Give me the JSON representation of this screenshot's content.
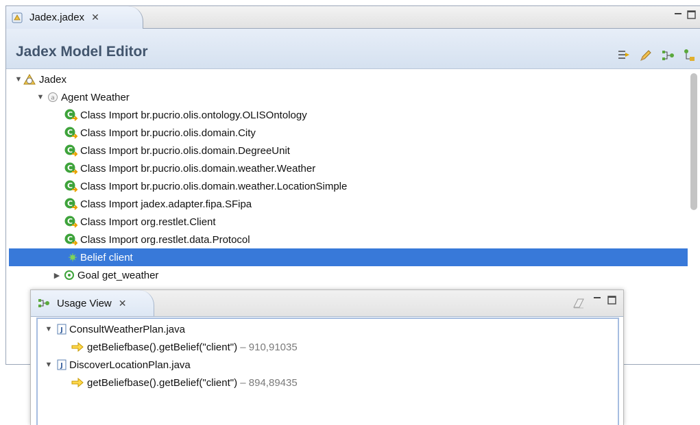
{
  "editor": {
    "tab_label": "Jadex.jadex",
    "close_glyph": "✕",
    "title": "Jadex Model Editor",
    "tools": [
      "filter-icon",
      "pencil-icon",
      "usage-view-icon",
      "hierarchy-icon"
    ]
  },
  "tree": {
    "root": "Jadex",
    "agent": "Agent Weather",
    "imports": [
      "Class Import br.pucrio.olis.ontology.OLISOntology",
      "Class Import br.pucrio.olis.domain.City",
      "Class Import br.pucrio.olis.domain.DegreeUnit",
      "Class Import br.pucrio.olis.domain.weather.Weather",
      "Class Import br.pucrio.olis.domain.weather.LocationSimple",
      "Class Import jadex.adapter.fipa.SFipa",
      "Class Import org.restlet.Client",
      "Class Import org.restlet.data.Protocol"
    ],
    "belief": "Belief client",
    "goal": "Goal get_weather"
  },
  "usage": {
    "tab_label": "Usage View",
    "files": [
      {
        "name": "ConsultWeatherPlan.java",
        "call": "getBeliefbase().getBelief(\"client\")",
        "sep": " – ",
        "location": "910,91035"
      },
      {
        "name": "DiscoverLocationPlan.java",
        "call": "getBeliefbase().getBelief(\"client\")",
        "sep": " – ",
        "location": "894,89435"
      }
    ]
  },
  "colors": {
    "selection": "#3879d9",
    "header_text": "#42556d",
    "import_icon": "#3ea33b"
  }
}
